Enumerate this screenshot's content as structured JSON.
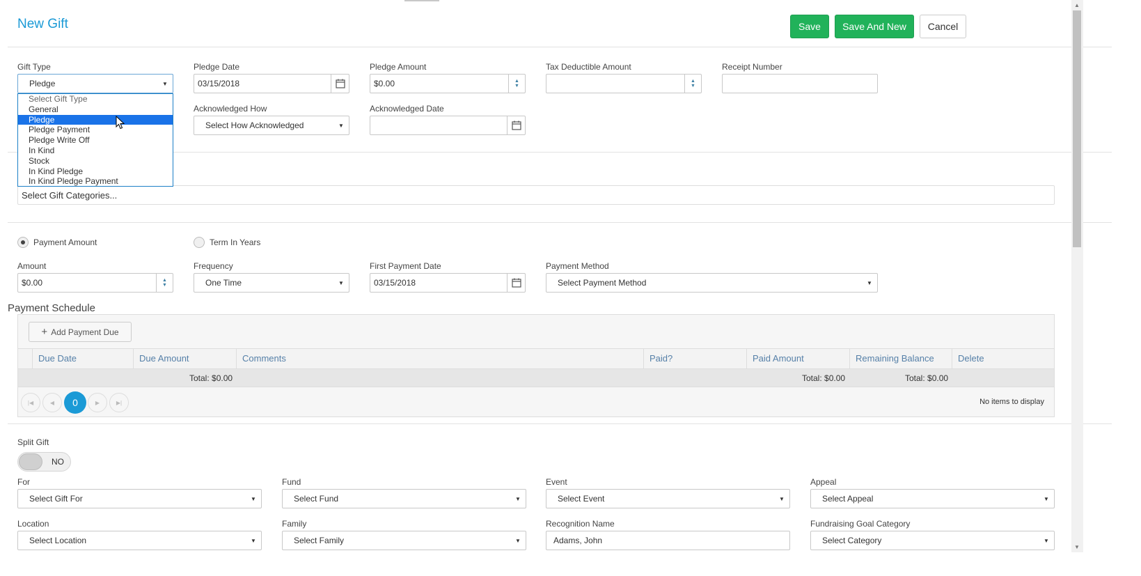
{
  "header": {
    "title": "New Gift",
    "save_label": "Save",
    "save_new_label": "Save And New",
    "cancel_label": "Cancel"
  },
  "gift_type": {
    "label": "Gift Type",
    "value": "Pledge",
    "options": [
      "Select Gift Type",
      "General",
      "Pledge",
      "Pledge Payment",
      "Pledge Write Off",
      "In Kind",
      "Stock",
      "In Kind Pledge",
      "In Kind Pledge Payment"
    ]
  },
  "pledge_date": {
    "label": "Pledge Date",
    "value": "03/15/2018"
  },
  "pledge_amount": {
    "label": "Pledge Amount",
    "value": "$0.00"
  },
  "tax_deductible": {
    "label": "Tax Deductible Amount",
    "value": ""
  },
  "receipt_number": {
    "label": "Receipt Number",
    "value": ""
  },
  "ack_how": {
    "label": "Acknowledged How",
    "value": "Select How Acknowledged"
  },
  "ack_date": {
    "label": "Acknowledged Date",
    "value": ""
  },
  "categories": {
    "placeholder": "Select Gift Categories..."
  },
  "radio": {
    "payment_amount": "Payment Amount",
    "term_years": "Term In Years"
  },
  "amount": {
    "label": "Amount",
    "value": "$0.00"
  },
  "frequency": {
    "label": "Frequency",
    "value": "One Time"
  },
  "first_payment_date": {
    "label": "First Payment Date",
    "value": "03/15/2018"
  },
  "payment_method": {
    "label": "Payment Method",
    "value": "Select Payment Method"
  },
  "schedule": {
    "title": "Payment Schedule",
    "add_label": "Add Payment Due",
    "columns": [
      "Due Date",
      "Due Amount",
      "Comments",
      "Paid?",
      "Paid Amount",
      "Remaining Balance",
      "Delete"
    ],
    "total_due": "Total: $0.00",
    "total_paid": "Total: $0.00",
    "total_remaining": "Total: $0.00",
    "page": "0",
    "empty": "No items to display"
  },
  "split": {
    "label": "Split Gift",
    "value": "NO"
  },
  "for": {
    "label": "For",
    "value": "Select Gift For"
  },
  "fund": {
    "label": "Fund",
    "value": "Select Fund"
  },
  "event": {
    "label": "Event",
    "value": "Select Event"
  },
  "appeal": {
    "label": "Appeal",
    "value": "Select Appeal"
  },
  "location": {
    "label": "Location",
    "value": "Select Location"
  },
  "family": {
    "label": "Family",
    "value": "Select Family"
  },
  "recognition": {
    "label": "Recognition Name",
    "value": "Adams, John"
  },
  "goal_category": {
    "label": "Fundraising Goal Category",
    "value": "Select Category"
  },
  "icons": {
    "calendar": "calendar-icon",
    "spinner": "spinner-icon",
    "caret": "caret-down-icon",
    "plus": "plus-icon"
  },
  "colors": {
    "accent": "#1b9ad6",
    "green": "#21b25a",
    "selected": "#1a73e8"
  }
}
